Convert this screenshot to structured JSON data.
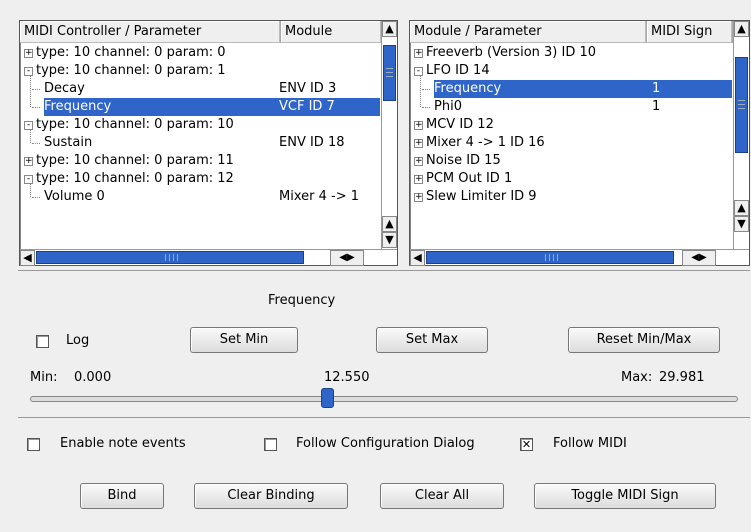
{
  "left_list": {
    "columns": [
      "MIDI Controller / Parameter",
      "Module"
    ],
    "rows": [
      {
        "text": "type: 10 channel: 0 param: 0",
        "module": "",
        "depth": 0,
        "expander": "+",
        "selected": false
      },
      {
        "text": "type: 10 channel: 0 param: 1",
        "module": "",
        "depth": 0,
        "expander": "-",
        "selected": false
      },
      {
        "text": "Decay",
        "module": "ENV ID 3",
        "depth": 1,
        "expander": "",
        "selected": false
      },
      {
        "text": "Frequency",
        "module": "VCF ID 7",
        "depth": 1,
        "expander": "",
        "selected": true
      },
      {
        "text": "type: 10 channel: 0 param: 10",
        "module": "",
        "depth": 0,
        "expander": "-",
        "selected": false
      },
      {
        "text": "Sustain",
        "module": "ENV ID 18",
        "depth": 1,
        "expander": "",
        "selected": false
      },
      {
        "text": "type: 10 channel: 0 param: 11",
        "module": "",
        "depth": 0,
        "expander": "+",
        "selected": false
      },
      {
        "text": "type: 10 channel: 0 param: 12",
        "module": "",
        "depth": 0,
        "expander": "-",
        "selected": false
      },
      {
        "text": "Volume 0",
        "module": "Mixer 4 -> 1",
        "depth": 1,
        "expander": "",
        "selected": false
      }
    ]
  },
  "right_list": {
    "columns": [
      "Module / Parameter",
      "MIDI Sign"
    ],
    "rows": [
      {
        "text": "Freeverb (Version 3) ID 10",
        "module": "",
        "depth": 0,
        "expander": "+",
        "selected": false
      },
      {
        "text": "LFO ID 14",
        "module": "",
        "depth": 0,
        "expander": "-",
        "selected": false
      },
      {
        "text": "Frequency",
        "module": "1",
        "depth": 1,
        "expander": "",
        "selected": true
      },
      {
        "text": "Phi0",
        "module": "1",
        "depth": 1,
        "expander": "",
        "selected": false
      },
      {
        "text": "MCV ID 12",
        "module": "",
        "depth": 0,
        "expander": "+",
        "selected": false
      },
      {
        "text": "Mixer 4 -> 1 ID 16",
        "module": "",
        "depth": 0,
        "expander": "+",
        "selected": false
      },
      {
        "text": "Noise ID 15",
        "module": "",
        "depth": 0,
        "expander": "+",
        "selected": false
      },
      {
        "text": "PCM Out ID 1",
        "module": "",
        "depth": 0,
        "expander": "+",
        "selected": false
      },
      {
        "text": "Slew Limiter ID 9",
        "module": "",
        "depth": 0,
        "expander": "+",
        "selected": false
      }
    ]
  },
  "param": {
    "title": "Frequency",
    "log_label": "Log",
    "log_checked": false,
    "set_min": "Set Min",
    "set_max": "Set Max",
    "reset": "Reset Min/Max",
    "min_label": "Min:",
    "min_value": "0.000",
    "current_value": "12.550",
    "max_label": "Max:",
    "max_value": "29.981",
    "slider_fraction": 0.4186
  },
  "options": {
    "enable_note": "Enable note events",
    "enable_note_checked": false,
    "follow_config": "Follow Configuration Dialog",
    "follow_config_checked": false,
    "follow_midi": "Follow MIDI",
    "follow_midi_checked": true
  },
  "actions": {
    "bind": "Bind",
    "clear_binding": "Clear Binding",
    "clear_all": "Clear All",
    "toggle_sign": "Toggle MIDI Sign"
  },
  "scroll_glyphs": {
    "up": "🠅",
    "down": "🠇",
    "left": "🠄",
    "right": "🠆"
  }
}
